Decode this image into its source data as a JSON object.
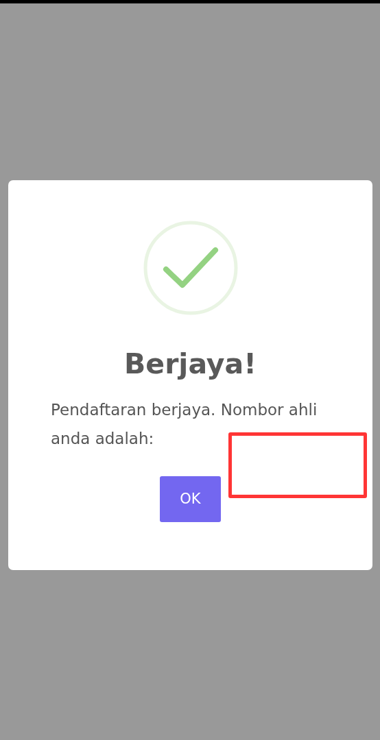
{
  "dialog": {
    "title": "Berjaya!",
    "message": "Pendaftaran berjaya. Nombor ahli anda adalah:",
    "buttons": [
      {
        "label": "OK"
      }
    ]
  }
}
